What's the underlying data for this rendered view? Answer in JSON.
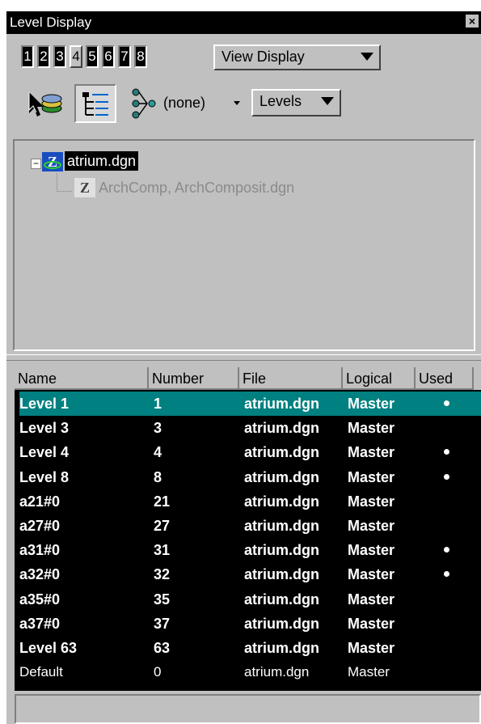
{
  "window": {
    "title": "Level Display",
    "close": "×"
  },
  "views": [
    {
      "label": "1",
      "on": true
    },
    {
      "label": "2",
      "on": true
    },
    {
      "label": "3",
      "on": true
    },
    {
      "label": "4",
      "on": false
    },
    {
      "label": "5",
      "on": true
    },
    {
      "label": "6",
      "on": true
    },
    {
      "label": "7",
      "on": true
    },
    {
      "label": "8",
      "on": true
    }
  ],
  "view_display": {
    "label": "View Display"
  },
  "toolbar": {
    "filter_value": "(none)",
    "levels_label": "Levels"
  },
  "tree": {
    "root": {
      "label": "atrium.dgn",
      "expander": "−"
    },
    "child": {
      "label": "ArchComp, ArchComposit.dgn"
    }
  },
  "table": {
    "columns": [
      "Name",
      "Number",
      "File",
      "Logical",
      "Used"
    ],
    "rows": [
      {
        "name": "Level 1",
        "number": "1",
        "file": "atrium.dgn",
        "logical": "Master",
        "used": true,
        "selected": true,
        "bold": true
      },
      {
        "name": "Level 3",
        "number": "3",
        "file": "atrium.dgn",
        "logical": "Master",
        "used": false,
        "selected": false,
        "bold": true
      },
      {
        "name": "Level 4",
        "number": "4",
        "file": "atrium.dgn",
        "logical": "Master",
        "used": true,
        "selected": false,
        "bold": true
      },
      {
        "name": "Level 8",
        "number": "8",
        "file": "atrium.dgn",
        "logical": "Master",
        "used": true,
        "selected": false,
        "bold": true
      },
      {
        "name": "a21#0",
        "number": "21",
        "file": "atrium.dgn",
        "logical": "Master",
        "used": false,
        "selected": false,
        "bold": true
      },
      {
        "name": "a27#0",
        "number": "27",
        "file": "atrium.dgn",
        "logical": "Master",
        "used": false,
        "selected": false,
        "bold": true
      },
      {
        "name": "a31#0",
        "number": "31",
        "file": "atrium.dgn",
        "logical": "Master",
        "used": true,
        "selected": false,
        "bold": true
      },
      {
        "name": "a32#0",
        "number": "32",
        "file": "atrium.dgn",
        "logical": "Master",
        "used": true,
        "selected": false,
        "bold": true
      },
      {
        "name": "a35#0",
        "number": "35",
        "file": "atrium.dgn",
        "logical": "Master",
        "used": false,
        "selected": false,
        "bold": true
      },
      {
        "name": "a37#0",
        "number": "37",
        "file": "atrium.dgn",
        "logical": "Master",
        "used": false,
        "selected": false,
        "bold": true
      },
      {
        "name": "Level 63",
        "number": "63",
        "file": "atrium.dgn",
        "logical": "Master",
        "used": false,
        "selected": false,
        "bold": true
      },
      {
        "name": "Default",
        "number": "0",
        "file": "atrium.dgn",
        "logical": "Master",
        "used": false,
        "selected": false,
        "bold": false
      }
    ]
  },
  "icons": {
    "element_select": "element-selection-icon",
    "tree_view": "tree-list-icon",
    "filter": "filter-icon"
  },
  "colors": {
    "selection": "#008080",
    "face": "#c0c0c0",
    "list_bg": "#000000"
  }
}
